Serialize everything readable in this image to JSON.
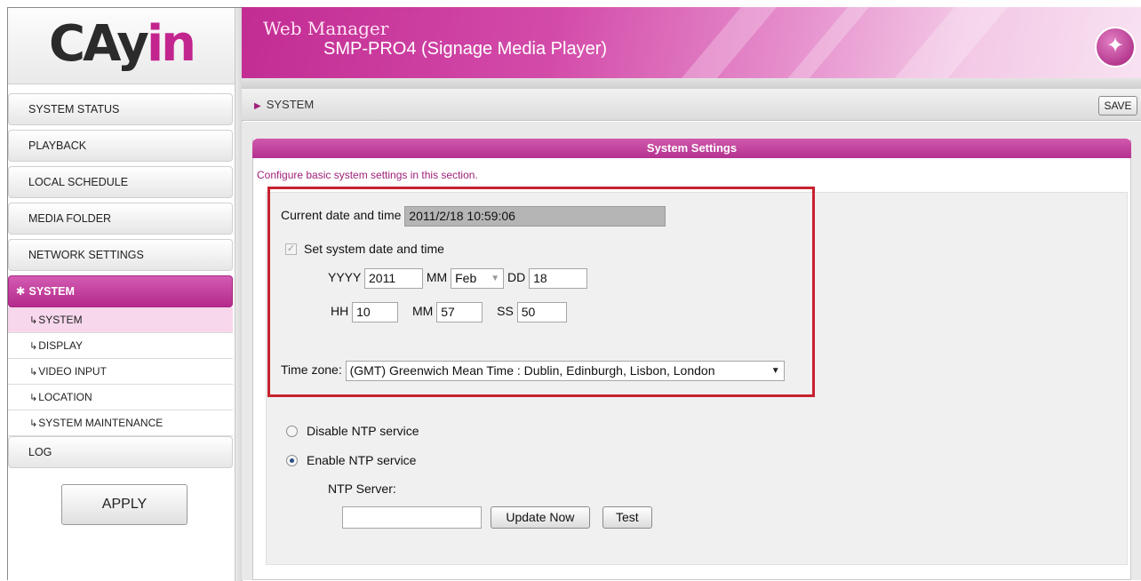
{
  "brand": {
    "logo_text_dark": "CAy",
    "logo_text_accent": "in",
    "accent_color": "#c3258e"
  },
  "header": {
    "title": "Web Manager",
    "subtitle": "SMP-PRO4 (Signage Media Player)",
    "wand_icon": "magic-wand-icon"
  },
  "sidebar": {
    "items": [
      {
        "label": "SYSTEM STATUS"
      },
      {
        "label": "PLAYBACK"
      },
      {
        "label": "LOCAL SCHEDULE"
      },
      {
        "label": "MEDIA FOLDER"
      },
      {
        "label": "NETWORK SETTINGS"
      },
      {
        "label": "SYSTEM"
      },
      {
        "label": "LOG"
      }
    ],
    "submenu": [
      {
        "label": "SYSTEM"
      },
      {
        "label": "DISPLAY"
      },
      {
        "label": "VIDEO INPUT"
      },
      {
        "label": "LOCATION"
      },
      {
        "label": "SYSTEM MAINTENANCE"
      }
    ],
    "apply_label": "APPLY"
  },
  "breadcrumb": {
    "label": "SYSTEM"
  },
  "toolbar": {
    "save_label": "SAVE"
  },
  "panel": {
    "title": "System Settings",
    "description": "Configure basic system settings in this section."
  },
  "settings": {
    "current_label": "Current date and time",
    "current_value": "2011/2/18   10:59:06",
    "set_label": "Set system date and time",
    "yyyy_label": "YYYY",
    "yyyy_value": "2011",
    "mon_label": "MM",
    "mon_value": "Feb",
    "dd_label": "DD",
    "dd_value": "18",
    "hh_label": "HH",
    "hh_value": "10",
    "min_label": "MM",
    "min_value": "57",
    "ss_label": "SS",
    "ss_value": "50",
    "tz_label": "Time zone:",
    "tz_value": "(GMT) Greenwich Mean Time : Dublin, Edinburgh, Lisbon, London"
  },
  "ntp": {
    "disable_label": "Disable NTP service",
    "enable_label": "Enable NTP service",
    "server_label": "NTP Server:",
    "server_value": "",
    "update_label": "Update Now",
    "test_label": "Test"
  }
}
